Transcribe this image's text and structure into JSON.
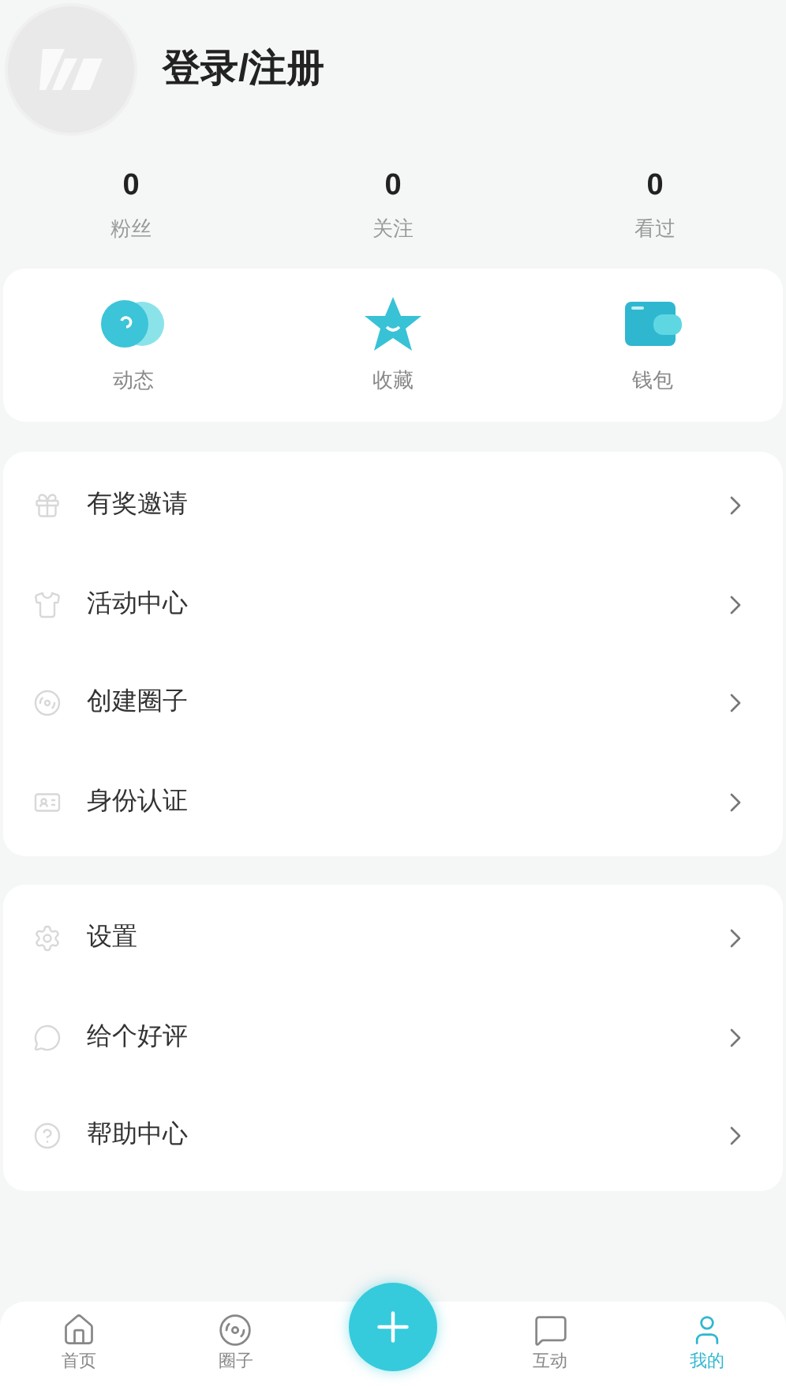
{
  "profile": {
    "login_text": "登录/注册"
  },
  "stats": [
    {
      "value": "0",
      "label": "粉丝"
    },
    {
      "value": "0",
      "label": "关注"
    },
    {
      "value": "0",
      "label": "看过"
    }
  ],
  "shortcuts": [
    {
      "kind": "feed",
      "label": "动态"
    },
    {
      "kind": "star",
      "label": "收藏"
    },
    {
      "kind": "wallet",
      "label": "钱包"
    }
  ],
  "menu_groups": [
    [
      {
        "kind": "gift",
        "label": "有奖邀请"
      },
      {
        "kind": "activity",
        "label": "活动中心"
      },
      {
        "kind": "circle",
        "label": "创建圈子"
      },
      {
        "kind": "id",
        "label": "身份认证"
      }
    ],
    [
      {
        "kind": "settings",
        "label": "设置"
      },
      {
        "kind": "rate",
        "label": "给个好评"
      },
      {
        "kind": "help",
        "label": "帮助中心"
      }
    ]
  ],
  "tab_bar": [
    {
      "kind": "home",
      "label": "首页",
      "selected": false
    },
    {
      "kind": "circle",
      "label": "圈子",
      "selected": false
    },
    {
      "kind": "chat",
      "label": "互动",
      "selected": false
    },
    {
      "kind": "user",
      "label": "我的",
      "selected": true
    }
  ]
}
